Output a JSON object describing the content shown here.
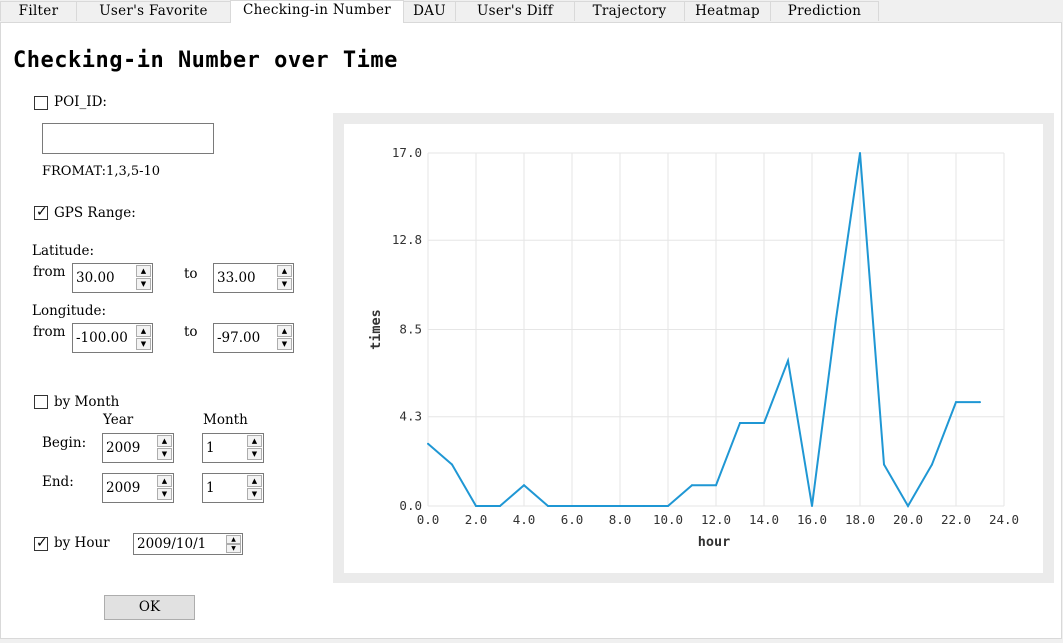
{
  "tabs": [
    {
      "label": "Filter"
    },
    {
      "label": "User's Favorite"
    },
    {
      "label": "Checking-in Number"
    },
    {
      "label": "DAU"
    },
    {
      "label": "User's Diff"
    },
    {
      "label": "Trajectory"
    },
    {
      "label": "Heatmap"
    },
    {
      "label": "Prediction"
    }
  ],
  "active_tab": "Checking-in Number",
  "page_title": "Checking-in Number over Time",
  "poi": {
    "label": "POI_ID:",
    "checked": false,
    "value": "",
    "format_hint": "FROMAT:1,3,5-10"
  },
  "gps": {
    "label": "GPS Range:",
    "checked": true,
    "latitude_label": "Latitude:",
    "longitude_label": "Longitude:",
    "from_label": "from",
    "to_label": "to",
    "lat_from": "30.00",
    "lat_to": "33.00",
    "lon_from": "-100.00",
    "lon_to": "-97.00"
  },
  "month": {
    "label": "by Month",
    "checked": false,
    "year_label": "Year",
    "month_label": "Month",
    "begin_label": "Begin:",
    "end_label": "End:",
    "begin_year": "2009",
    "begin_month": "1",
    "end_year": "2009",
    "end_month": "1"
  },
  "hour": {
    "label": "by Hour",
    "checked": true,
    "date": "2009/10/1"
  },
  "ok_label": "OK",
  "colors": {
    "line": "#1f97d4",
    "grid": "#e6e6e6"
  },
  "chart_data": {
    "type": "line",
    "xlabel": "hour",
    "ylabel": "times",
    "xlim": [
      0,
      24
    ],
    "ylim": [
      0,
      17
    ],
    "x_ticks": [
      "0.0",
      "2.0",
      "4.0",
      "6.0",
      "8.0",
      "10.0",
      "12.0",
      "14.0",
      "16.0",
      "18.0",
      "20.0",
      "22.0",
      "24.0"
    ],
    "y_ticks": [
      "0.0",
      "4.3",
      "8.5",
      "12.8",
      "17.0"
    ],
    "grid": true,
    "series": [
      {
        "x": [
          0,
          1,
          2,
          3,
          4,
          5,
          6,
          7,
          8,
          9,
          10,
          11,
          12,
          13,
          14,
          15,
          16,
          17,
          18,
          19,
          20,
          21,
          22,
          23
        ],
        "values": [
          3,
          2,
          0,
          0,
          1,
          0,
          0,
          0,
          0,
          0,
          0,
          1,
          1,
          4,
          4,
          7,
          0,
          9,
          17,
          2,
          0,
          2,
          5,
          5
        ]
      }
    ]
  }
}
